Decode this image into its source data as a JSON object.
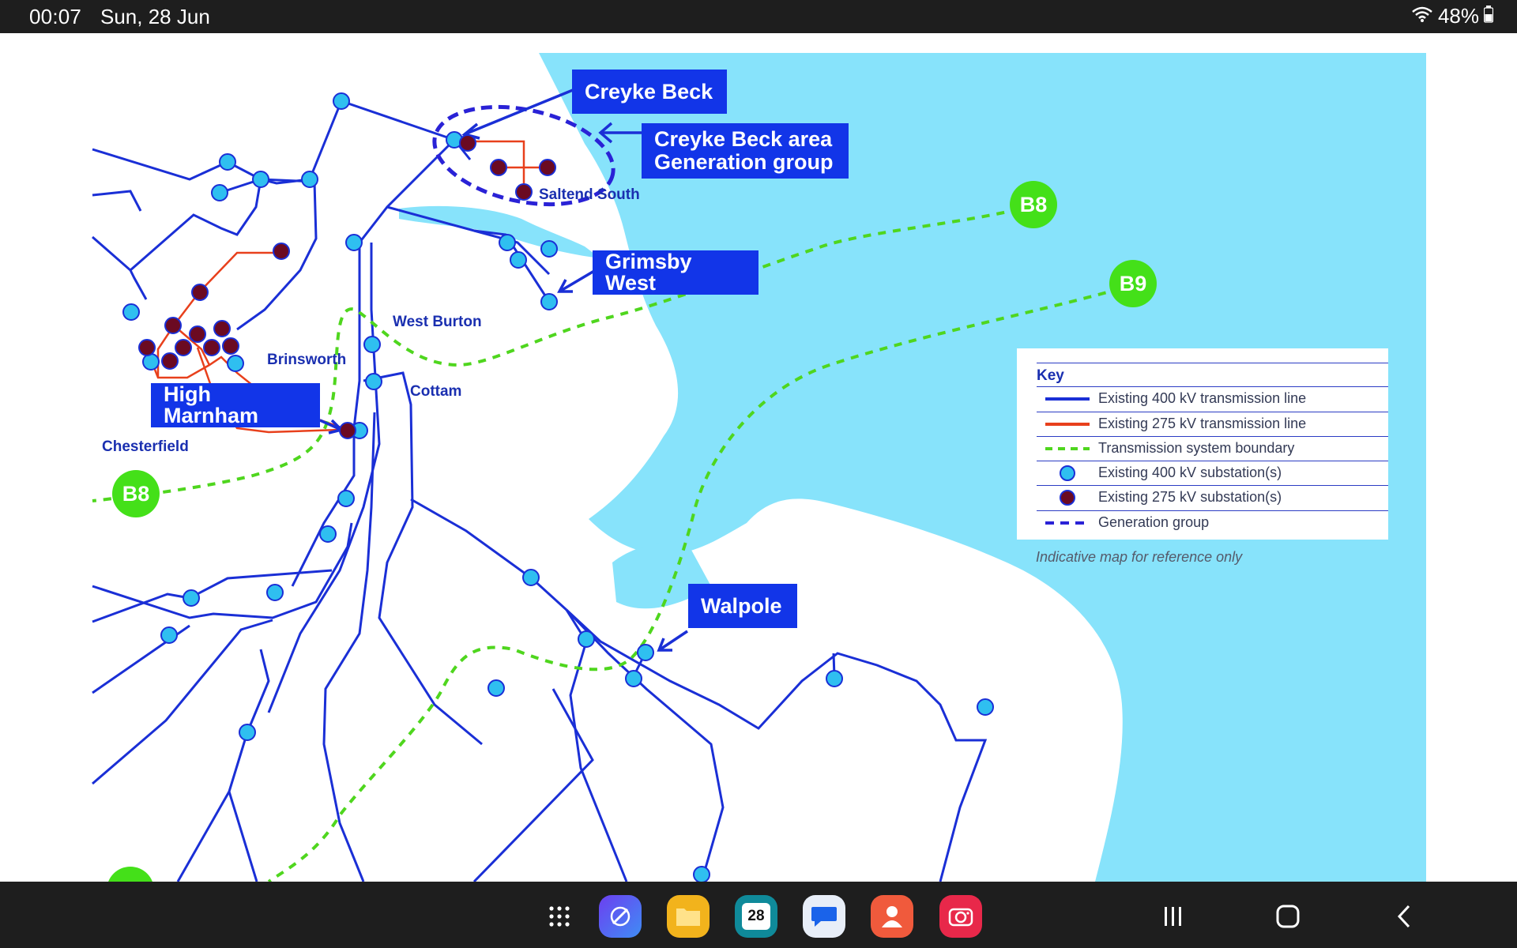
{
  "status_bar": {
    "time": "00:07",
    "date": "Sun, 28 Jun",
    "battery": "48%",
    "wifi_icon": "wifi-icon",
    "battery_icon": "battery-icon"
  },
  "map": {
    "callouts": {
      "creyke_beck": "Creyke Beck",
      "creyke_group_line1": "Creyke Beck area",
      "creyke_group_line2": "Generation group",
      "grimsby_west": "Grimsby West",
      "high_marnham": "High Marnham",
      "walpole": "Walpole"
    },
    "places": {
      "saltend_south": "Saltend South",
      "west_burton": "West Burton",
      "brinsworth": "Brinsworth",
      "cottam": "Cottam",
      "chesterfield": "Chesterfield"
    },
    "boundaries": {
      "b8_east": "B8",
      "b9": "B9",
      "b8_west": "B8"
    },
    "colors": {
      "sea": "#87e3fb",
      "line_400kv": "#1a2fd6",
      "line_275kv": "#e8401c",
      "boundary": "#4fd61e",
      "substation_400kv": "#2fbff0",
      "substation_275kv": "#6b0a22",
      "callout_bg": "#1235e8"
    }
  },
  "key": {
    "title": "Key",
    "items": [
      {
        "label": "Existing 400 kV transmission line",
        "symbol": "line-400kv"
      },
      {
        "label": "Existing 275 kV transmission line",
        "symbol": "line-275kv"
      },
      {
        "label": "Transmission system boundary",
        "symbol": "boundary-dashed"
      },
      {
        "label": "Existing 400 kV substation(s)",
        "symbol": "substation-400kv"
      },
      {
        "label": "Existing 275 kV substation(s)",
        "symbol": "substation-275kv"
      },
      {
        "label": "Generation group",
        "symbol": "generation-group-dashed"
      }
    ],
    "note": "Indicative map for reference only"
  },
  "nav_bar": {
    "calendar_day": "28",
    "apps": [
      "apps-grid-icon",
      "browser-icon",
      "files-icon",
      "calendar-icon",
      "messages-icon",
      "contacts-icon",
      "camera-icon"
    ],
    "buttons": [
      "recent-apps-icon",
      "home-icon",
      "back-icon"
    ]
  }
}
